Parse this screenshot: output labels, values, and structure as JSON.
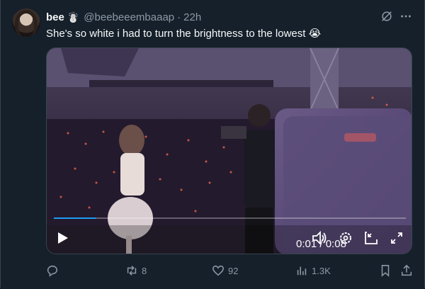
{
  "tweet": {
    "display_name": "bee",
    "name_emoji": "☃️",
    "handle": "@beebeeembaaap",
    "separator": "·",
    "timestamp": "22h",
    "text": "She's so white i had to turn the brightness to the lowest 😭"
  },
  "video": {
    "current_time": "0:01",
    "time_separator": " / ",
    "duration": "0:08",
    "progress_fraction": 0.12
  },
  "actions": {
    "replies": "",
    "reposts": "8",
    "likes": "92",
    "views": "1.3K"
  },
  "icons": {
    "reply": "reply-icon",
    "repost": "repost-icon",
    "like": "heart-icon",
    "views": "views-icon",
    "bookmark": "bookmark-icon",
    "share": "share-icon",
    "grok": "grok-icon",
    "more": "more-icon"
  },
  "colors": {
    "background": "#15202b",
    "secondary_text": "#8b98a5",
    "border": "#38444d"
  }
}
